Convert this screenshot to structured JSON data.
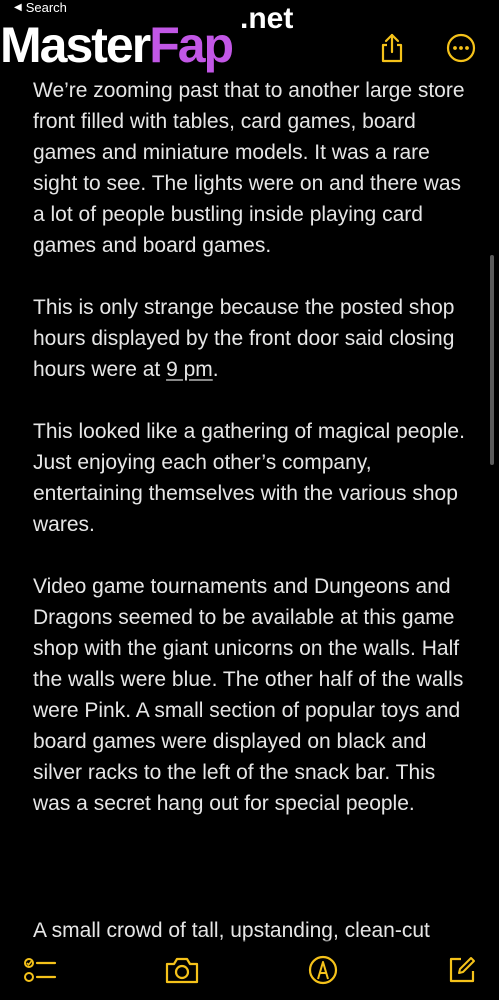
{
  "status_bar": {
    "back_label": "Search"
  },
  "watermark": {
    "main": "Master",
    "accent": "Fap",
    "suffix": ".net"
  },
  "note": {
    "paragraphs": [
      "We’re zooming past that to another large store front filled with tables, card games, board games and miniature models. It was a rare sight to see. The lights were on and there was a lot of people bustling inside playing card games and board games.",
      "This is only strange because the posted shop hours displayed by the front door said closing hours were at ",
      "This looked like a gathering of magical people. Just enjoying each other’s company, entertaining themselves with the various shop wares.",
      "Video game tournaments and Dungeons and Dragons seemed to be available at this game shop with the giant unicorns on the walls. Half the walls were blue. The other half of the walls were Pink. A small section of popular toys and board games were displayed on black and silver racks to the left of the snack bar. This was a secret hang out for special people."
    ],
    "time_link": "9 pm",
    "p2_end": ".",
    "partial_line": "A small crowd of tall, upstanding, clean-cut"
  },
  "colors": {
    "accent": "#f5c21a",
    "background": "#000000",
    "text": "#e6e6e6"
  },
  "icons": {
    "share": "share-icon",
    "more": "more-icon",
    "checklist": "checklist-icon",
    "camera": "camera-icon",
    "markup": "markup-pen-icon",
    "compose": "compose-icon"
  }
}
